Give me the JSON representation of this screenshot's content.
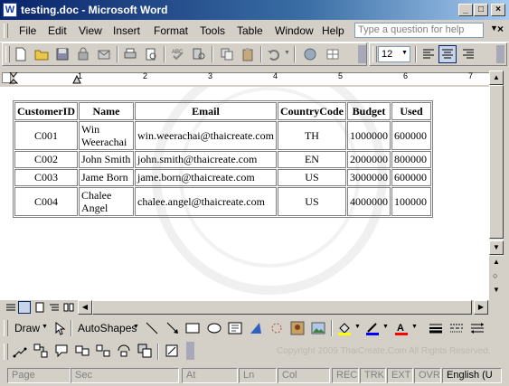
{
  "window": {
    "title": "testing.doc - Microsoft Word",
    "doc_icon_letter": "W",
    "minimize": "_",
    "maximize": "□",
    "close": "×"
  },
  "menu": {
    "items": [
      "File",
      "Edit",
      "View",
      "Insert",
      "Format",
      "Tools",
      "Table",
      "Window",
      "Help"
    ],
    "ask_placeholder": "Type a question for help",
    "close_doc": "×"
  },
  "formatting": {
    "font_size": "12"
  },
  "ruler": {
    "numbers": [
      "1",
      "2",
      "3",
      "4",
      "5",
      "6",
      "7"
    ]
  },
  "table": {
    "headers": [
      "CustomerID",
      "Name",
      "Email",
      "CountryCode",
      "Budget",
      "Used"
    ],
    "rows": [
      [
        "C001",
        "Win Weerachai",
        "win.weerachai@thaicreate.com",
        "TH",
        "1000000",
        "600000"
      ],
      [
        "C002",
        "John Smith",
        "john.smith@thaicreate.com",
        "EN",
        "2000000",
        "800000"
      ],
      [
        "C003",
        "Jame Born",
        "jame.born@thaicreate.com",
        "US",
        "3000000",
        "600000"
      ],
      [
        "C004",
        "Chalee Angel",
        "chalee.angel@thaicreate.com",
        "US",
        "4000000",
        "100000"
      ]
    ]
  },
  "drawing": {
    "draw_label": "Draw",
    "autoshapes_label": "AutoShapes",
    "copyright": "Copyright 2009 ThaiCreate.Com All Rights Reserved."
  },
  "status": {
    "page": "Page",
    "sec": "Sec",
    "at": "At",
    "ln": "Ln",
    "col": "Col",
    "rec": "REC",
    "trk": "TRK",
    "ext": "EXT",
    "ovr": "OVR",
    "language": "English (U"
  },
  "colors": {
    "title_start": "#0a246a",
    "title_end": "#a6caf0",
    "chrome": "#d4d0c8",
    "highlight": "#ffff00",
    "font_color": "#ff0000"
  }
}
